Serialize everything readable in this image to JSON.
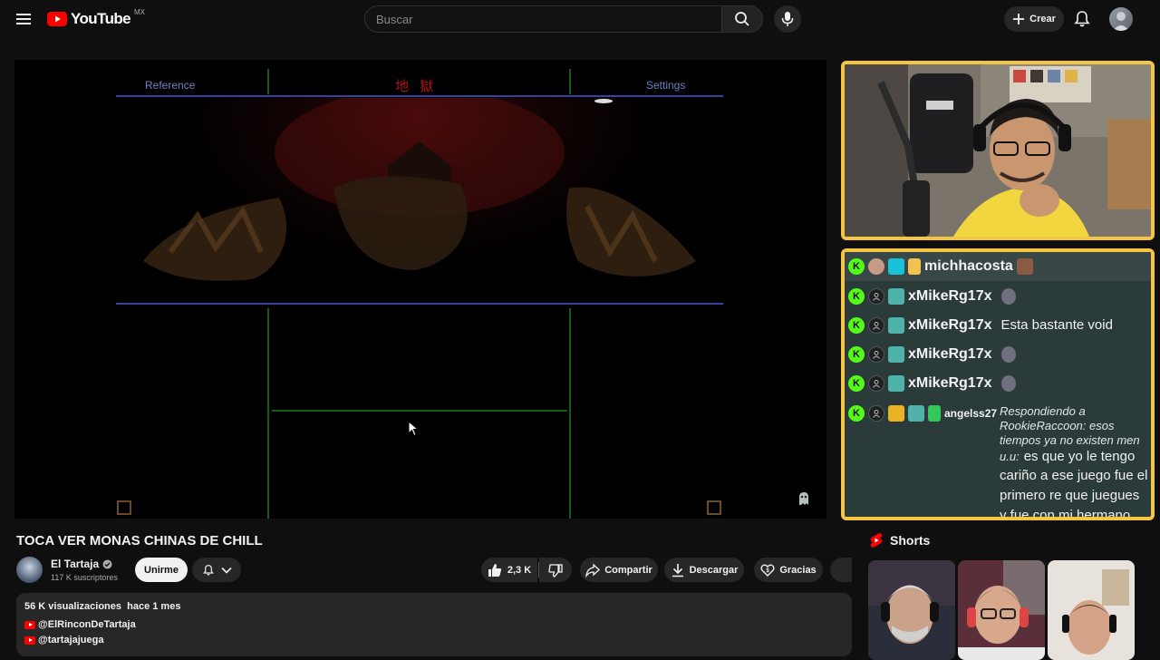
{
  "topbar": {
    "logo_text": "YouTube",
    "region": "MX",
    "search_placeholder": "Buscar",
    "create_label": "Crear"
  },
  "game": {
    "reference_label": "Reference",
    "center_label": "地 獄",
    "settings_label": "Settings"
  },
  "chat": {
    "rows": [
      {
        "user": "michhacosta",
        "message": ""
      },
      {
        "user": "xMikeRg17x",
        "message": ""
      },
      {
        "user": "xMikeRg17x",
        "message": "Esta bastante void"
      },
      {
        "user": "xMikeRg17x",
        "message": ""
      },
      {
        "user": "xMikeRg17x",
        "message": ""
      }
    ],
    "reply": {
      "user": "angelss27",
      "reply_line1": "Respondiendo a",
      "reply_line2": "RookieRaccoon: esos",
      "reply_line3": "tiempos ya no existen men",
      "reply_line4": "u.u:",
      "message_part1": "es que yo le tengo",
      "message_line2": "cariño a ese juego fue el",
      "message_line3": "primero re que juegues",
      "message_line4": "y fue con mi hermano"
    }
  },
  "video": {
    "title": "TOCA VER MONAS CHINAS DE CHILL",
    "channel_name": "El Tartaja",
    "subscribers": "117 K suscriptores",
    "join_label": "Unirme",
    "likes": "2,3 K",
    "share_label": "Compartir",
    "download_label": "Descargar",
    "thanks_label": "Gracias"
  },
  "description": {
    "views": "56 K visualizaciones",
    "date": "hace 1 mes",
    "link1": "@ElRinconDeTartaja",
    "link2": "@tartajajuega"
  },
  "shorts": {
    "heading": "Shorts"
  },
  "colors": {
    "accent_red": "#ff0000",
    "overlay_border": "#f4c542",
    "kick_green": "#53fc18",
    "chat_bg": "#2b3b3a"
  }
}
